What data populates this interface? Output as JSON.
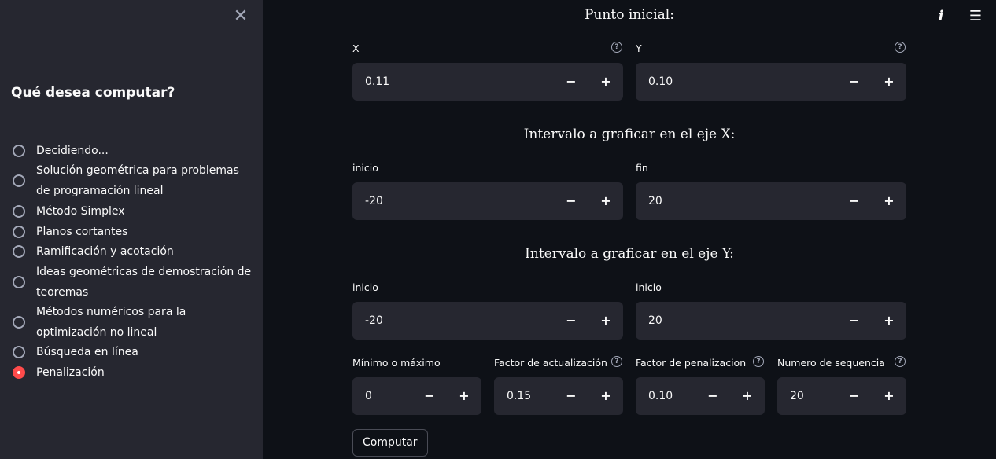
{
  "sidebar": {
    "title": "Qué desea computar?",
    "options": [
      {
        "label": "Decidiendo...",
        "selected": false
      },
      {
        "label": "Solución geométrica para problemas de programación lineal",
        "selected": false
      },
      {
        "label": "Método Simplex",
        "selected": false
      },
      {
        "label": "Planos cortantes",
        "selected": false
      },
      {
        "label": "Ramificación y acotación",
        "selected": false
      },
      {
        "label": "Ideas geométricas de demostración de teoremas",
        "selected": false
      },
      {
        "label": "Métodos numéricos para la optimización no lineal",
        "selected": false
      },
      {
        "label": "Búsqueda en línea",
        "selected": false
      },
      {
        "label": "Penalización",
        "selected": true
      }
    ]
  },
  "icons": {
    "close": "✕",
    "info": "i",
    "menu": "☰",
    "help": "?"
  },
  "buttons": {
    "minus": "−",
    "plus": "+"
  },
  "punto_inicial": {
    "title": "Punto inicial:",
    "x": {
      "label": "X",
      "value": "0.11"
    },
    "y": {
      "label": "Y",
      "value": "0.10"
    }
  },
  "intervalo_x": {
    "title": "Intervalo a graficar en el eje X:",
    "inicio": {
      "label": "inicio",
      "value": "-20"
    },
    "fin": {
      "label": "fin",
      "value": "20"
    }
  },
  "intervalo_y": {
    "title": "Intervalo a graficar en el eje Y:",
    "inicio": {
      "label": "inicio",
      "value": "-20"
    },
    "fin": {
      "label": "inicio",
      "value": "20"
    }
  },
  "params": {
    "min_max": {
      "label": "Mínimo o máximo",
      "value": "0"
    },
    "factor_act": {
      "label": "Factor de actualización",
      "value": "0.15"
    },
    "factor_pen": {
      "label": "Factor de penalizacion",
      "value": "0.10"
    },
    "num_seq": {
      "label": "Numero de sequencia",
      "value": "20"
    }
  },
  "submit_label": "Computar",
  "colors": {
    "accent": "#ff4b4b",
    "sidebar_bg": "#262730",
    "main_bg": "#0e1117"
  }
}
